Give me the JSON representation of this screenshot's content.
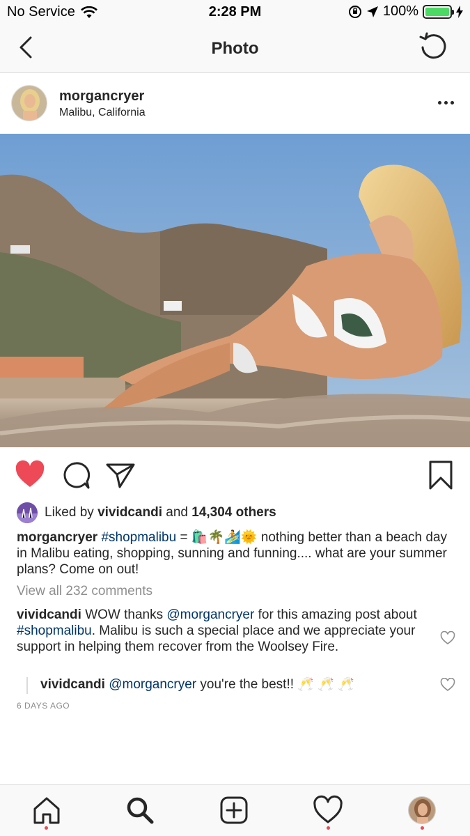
{
  "status_bar": {
    "carrier": "No Service",
    "time": "2:28 PM",
    "battery": "100%"
  },
  "nav": {
    "title": "Photo"
  },
  "post": {
    "username": "morgancryer",
    "location": "Malibu, California",
    "liked_by_prefix": "Liked by",
    "liked_by_user": "vividcandi",
    "liked_by_and": "and",
    "liked_by_count": "14,304 others",
    "caption": {
      "username": "morgancryer",
      "hashtag": "#shopmalibu",
      "emojis": " = 🛍️🌴🏄🌞 ",
      "text": "nothing better than a beach day in Malibu eating, shopping, sunning and funning.... what are your summer plans?  Come on out!"
    },
    "view_all_comments": "View all 232 comments",
    "comments": [
      {
        "username": "vividcandi",
        "text_a": " WOW thanks ",
        "mention": "@morgancryer",
        "text_b": " for this amazing post about ",
        "hashtag": "#shopmalibu",
        "text_c": ". Malibu is such a special place and we appreciate your support in helping them recover from the Woolsey Fire."
      },
      {
        "username": "vividcandi",
        "mention": "@morgancryer",
        "text": " you're the best!! 🥂 🥂 🥂"
      }
    ],
    "time_ago": "6 DAYS AGO"
  },
  "colors": {
    "like_red": "#ed4956",
    "hashtag_blue": "#003569",
    "muted_gray": "#8e8e8e",
    "battery_green": "#4cd964"
  },
  "tab_bar": {
    "items": [
      "home-icon",
      "search-icon",
      "add-post-icon",
      "activity-heart-icon",
      "profile-avatar"
    ]
  }
}
